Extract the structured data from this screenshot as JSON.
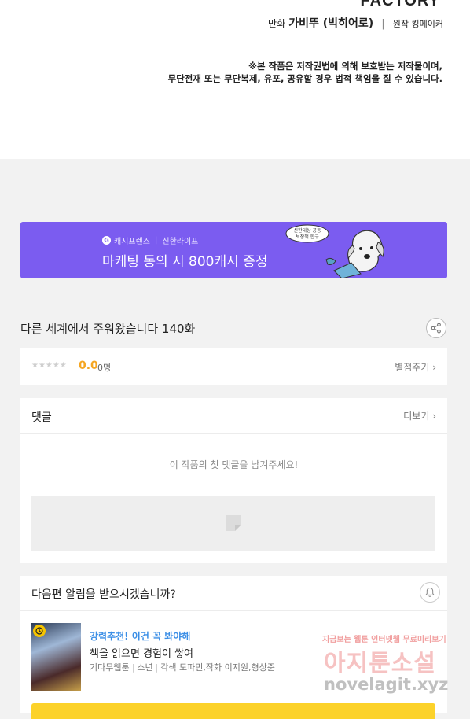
{
  "header": {
    "publisher": "FACTORY",
    "credits": {
      "art_role": "만화",
      "art_name": "가비뚜 (빅히어로)",
      "separator": "|",
      "original_label": "원작 킹메이커"
    },
    "notice": [
      "※본 작품은 저작권법에 의해 보호받는 저작물이며,",
      "무단전재 또는 무단복제, 유포, 공유할 경우 법적 책임을 질 수 있습니다."
    ]
  },
  "banner": {
    "brand_logo": "G",
    "brand_left": "캐시프렌즈",
    "brand_right": "신한라이프",
    "title": "마케팅 동의 시 800캐시 증정",
    "bubble": [
      "신한대상 공동",
      "보장책 합구"
    ]
  },
  "episode": {
    "title": "다른 세계에서 주워왔습니다 140화",
    "share_icon": "share-icon"
  },
  "rating": {
    "stars": "★★★★★",
    "score": "0.0",
    "count": "0명",
    "rate_link": "별점주기 ›",
    "score_color": "#f5a623"
  },
  "comments": {
    "title": "댓글",
    "more_link": "더보기 ›",
    "empty_message": "이 작품의 첫 댓글을 남겨주세요!"
  },
  "notify": {
    "question": "다음편 알림을 받으시겠습니까?",
    "bell_icon": "bell-icon"
  },
  "recommendation": {
    "label": "강력추천! 이건 꼭 봐야해",
    "title": "책을 읽으면 경험이 쌓여",
    "meta": [
      "기다무웹툰",
      "소년",
      "각색 도파민,작화 이지원,형상준"
    ],
    "label_color": "#3a8ee6",
    "button_color": "#fcd22a"
  },
  "watermark": {
    "tagline": "지금보는 웹툰 인터넷웹 무료미리보기",
    "name": "아지툰소설",
    "url": "novelagit.xyz"
  },
  "theme": {
    "banner_color": "#7b5cf0",
    "page_background": "#f2f2f2"
  }
}
